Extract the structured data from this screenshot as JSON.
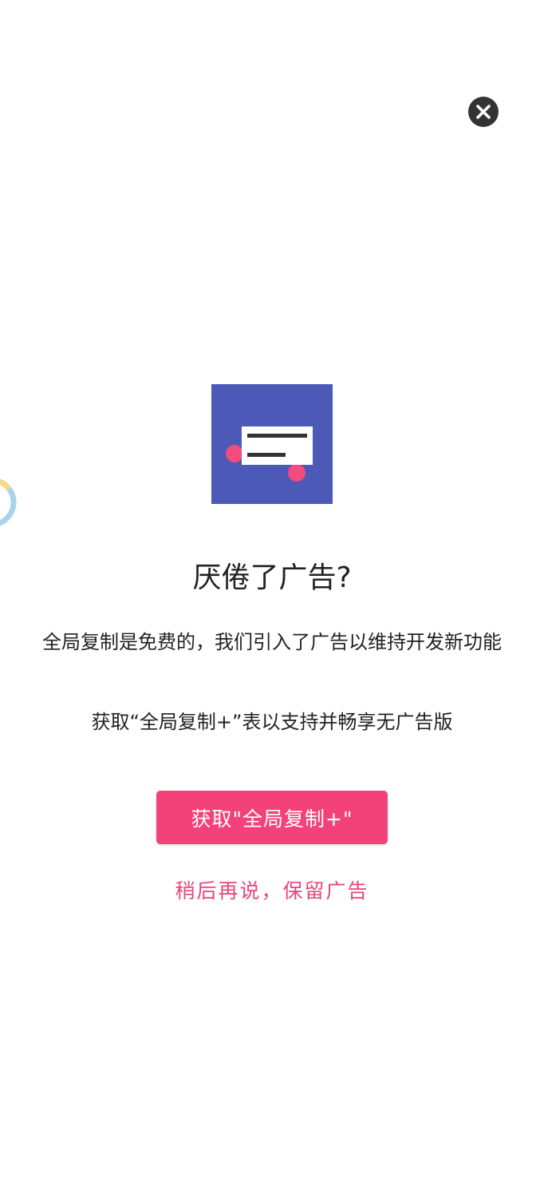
{
  "dialog": {
    "title": "厌倦了广告?",
    "description": "全局复制是免费的，我们引入了广告以维持开发新功能",
    "description2": "获取“全局复制+”表以支持并畅享无广告版",
    "primary_button_label": "获取\"全局复制+\"",
    "later_label": "稍后再说，保留广告"
  },
  "icons": {
    "close": "close-icon",
    "app_logo": "app-logo-icon",
    "floating_ball": "floating-ring-icon"
  },
  "colors": {
    "accent": "#f3427a",
    "link": "#e8457d",
    "logo_bg": "#4c59b7",
    "logo_dot": "#f04c7d",
    "close_bg": "#333333",
    "ring_blue": "#a9d3ec",
    "ring_yellow": "#f6d98a"
  }
}
